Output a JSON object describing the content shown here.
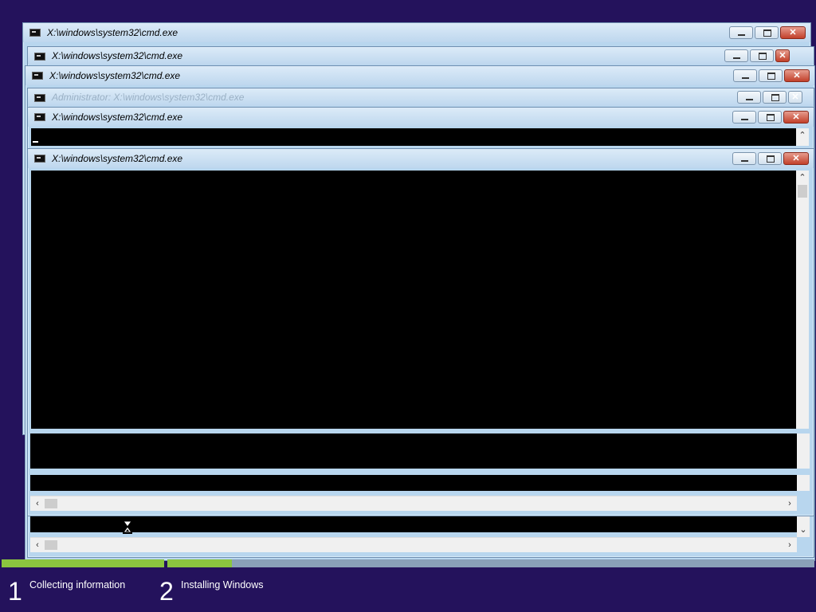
{
  "colors": {
    "desktop": "#24125c",
    "progress_done": "#8bc53f",
    "progress_todo": "#8aa0b8",
    "console_bg": "#000000"
  },
  "windows": [
    {
      "title": "X:\\windows\\system32\\cmd.exe"
    },
    {
      "title": "X:\\windows\\system32\\cmd.exe"
    },
    {
      "title": "X:\\windows\\system32\\cmd.exe"
    },
    {
      "title": "Administrator: X:\\windows\\system32\\cmd.exe"
    },
    {
      "title": "X:\\windows\\system32\\cmd.exe"
    },
    {
      "title": "X:\\windows\\system32\\cmd.exe"
    }
  ],
  "icons": {
    "cmd": "cmd-icon",
    "minimize": "minimize-icon",
    "maximize": "maximize-icon",
    "close": "close-icon",
    "wait": "hourglass-icon",
    "scroll_up": "chevron-up-icon",
    "scroll_down": "chevron-down-icon",
    "scroll_left": "chevron-left-icon",
    "scroll_right": "chevron-right-icon"
  },
  "setup": {
    "progress": {
      "step1_done": 1.0,
      "step2_done": 0.1
    },
    "steps": [
      {
        "number": "1",
        "label": "Collecting information"
      },
      {
        "number": "2",
        "label": "Installing Windows"
      }
    ]
  }
}
